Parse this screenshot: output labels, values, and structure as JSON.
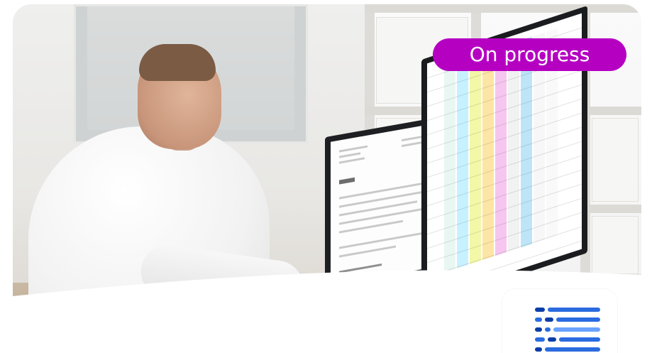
{
  "card": {
    "status_badge": "On progress",
    "status_color": "#b500c2",
    "photo_description_icon": "man-at-dual-monitors-photo"
  },
  "app_logo": {
    "icon": "stacked-dash-lines-logo",
    "colors": [
      "#0b3ea8",
      "#2a6be0",
      "#6aa3ff"
    ]
  }
}
